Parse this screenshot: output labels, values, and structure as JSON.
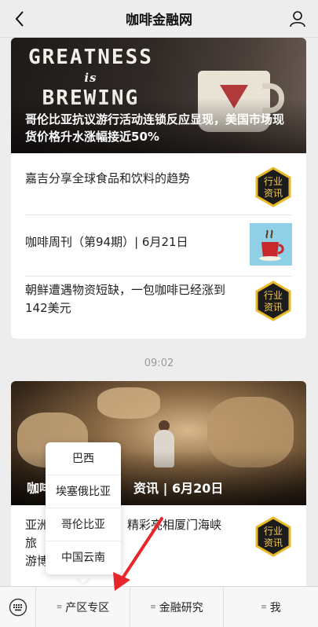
{
  "header": {
    "title": "咖啡金融网",
    "back_icon": "chevron-left-icon",
    "user_icon": "user-icon"
  },
  "feed": {
    "card1": {
      "hero": {
        "image_text_line1": "GREATNESS",
        "image_text_line2": "is",
        "image_text_line3": "BREWING",
        "caption": "哥伦比亚抗议游行活动连锁反应显现，美国市场现货价格升水涨幅接近50%"
      },
      "items": [
        {
          "text": "嘉吉分享全球食品和饮料的趋势",
          "badge_line1": "行业",
          "badge_line2": "资讯"
        },
        {
          "text": "咖啡周刊（第94期）| 6月21日",
          "thumb_icon": "coffee-cup-icon"
        },
        {
          "text": "朝鲜遭遇物资短缺，一包咖啡已经涨到142美元",
          "badge_line1": "行业",
          "badge_line2": "资讯"
        }
      ]
    },
    "timestamp": "09:02",
    "card2": {
      "hero": {
        "caption_left": "咖啡",
        "caption_right": "资讯 | 6月20日"
      },
      "items": [
        {
          "text_left": "亚洲",
          "text_right": "精彩亮相厦门海峡旅",
          "text_left2": "游博",
          "badge_line1": "行业",
          "badge_line2": "资讯"
        }
      ]
    }
  },
  "dropdown": {
    "options": [
      "巴西",
      "埃塞俄比亚",
      "哥伦比亚",
      "中国云南"
    ]
  },
  "tabbar": {
    "keyboard_icon": "keyboard-icon",
    "tabs": [
      {
        "label": "产区专区",
        "icon": "menu-icon"
      },
      {
        "label": "金融研究",
        "icon": "menu-icon"
      },
      {
        "label": "我",
        "icon": "menu-icon"
      }
    ]
  },
  "colors": {
    "background": "#ededed",
    "badge_fill": "#1c1c1c",
    "badge_border": "#e8b92b",
    "annotation_arrow": "#e8252b"
  }
}
